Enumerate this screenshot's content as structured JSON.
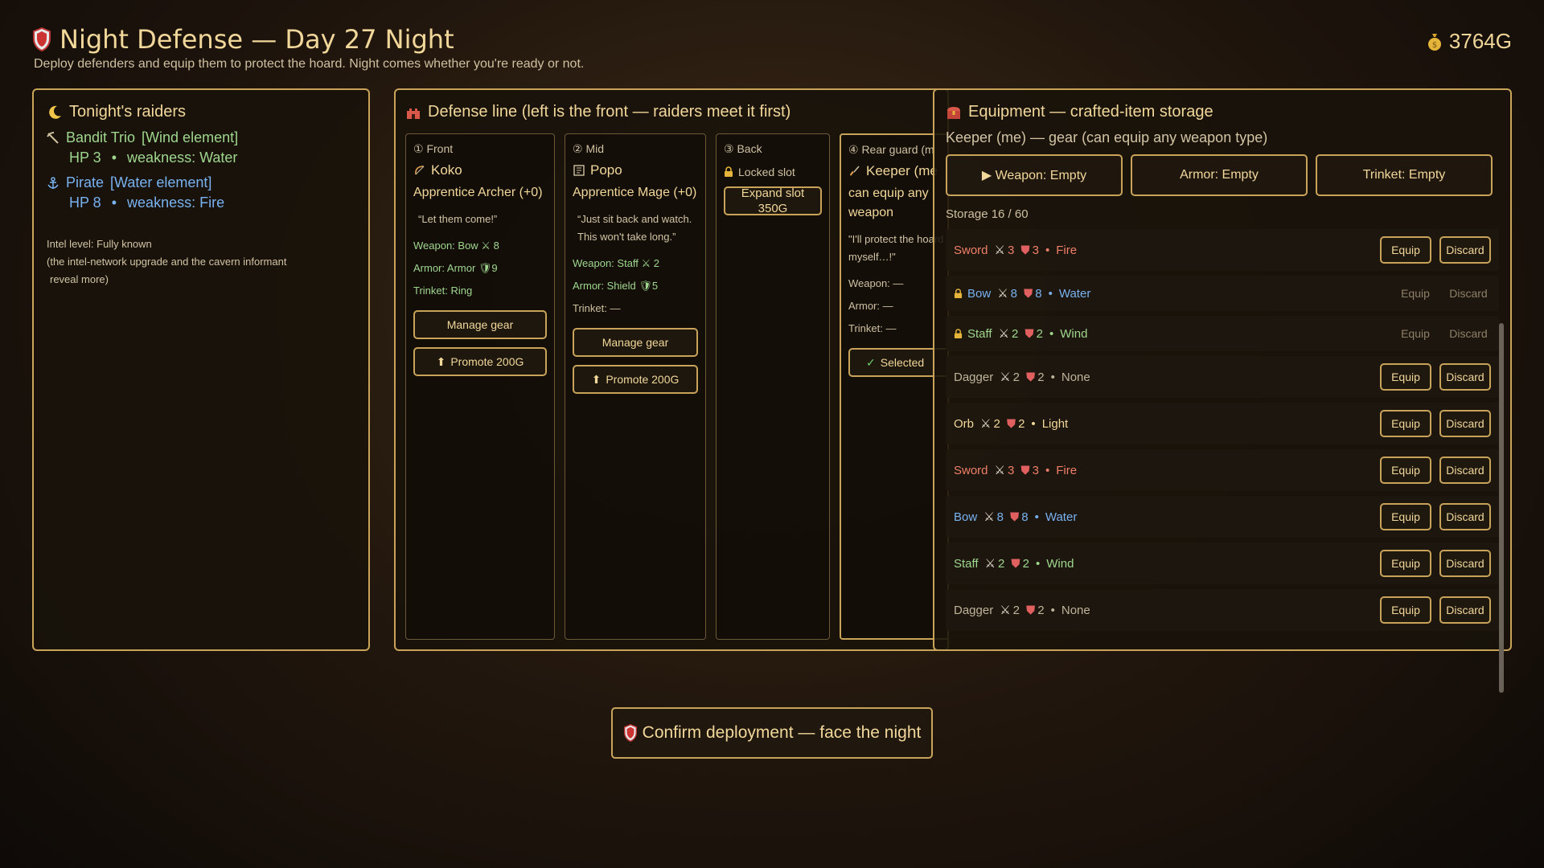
{
  "header": {
    "title": "Night Defense — Day 27 Night",
    "subtitle": "Deploy defenders and equip them to protect the hoard. Night comes whether you're ready or not.",
    "gold": "3764G"
  },
  "raiders": {
    "title": "Tonight's raiders",
    "list": [
      {
        "name": "Bandit Trio",
        "element": "[Wind element]",
        "hp": "HP 3",
        "sep": "•",
        "weakness": "weakness: Water",
        "color": "#9fd68e",
        "icon": "pickaxe-icon"
      },
      {
        "name": "Pirate",
        "element": "[Water element]",
        "hp": "HP 8",
        "sep": "•",
        "weakness": "weakness: Fire",
        "color": "#78b2f0",
        "icon": "anchor-icon"
      }
    ],
    "intel_level": "Intel level: Fully known",
    "intel_note_1": "(the intel-network upgrade and the cavern informant",
    "intel_note_2": "reveal more)"
  },
  "defense": {
    "title": "Defense line  (left is the front — raiders meet it first)",
    "slots": [
      {
        "pos": "① Front",
        "name": "Koko",
        "class": "Apprentice Archer (+0)",
        "quote": "“Let them come!”",
        "weapon": "Weapon: Bow ⚔ 8",
        "armor": "Armor: Armor 🛡9",
        "trinket": "Trinket: Ring",
        "manage": "Manage gear",
        "promote": "Promote 200G"
      },
      {
        "pos": "② Mid",
        "name": "Popo",
        "class": "Apprentice Mage (+0)",
        "quote": "“Just sit back and watch. This won't take long.”",
        "weapon": "Weapon: Staff ⚔ 2",
        "armor": "Armor: Shield 🛡5",
        "trinket": "Trinket: —",
        "manage": "Manage gear",
        "promote": "Promote 200G"
      },
      {
        "pos": "③ Back",
        "locked": "Locked slot",
        "expand_1": "Expand slot",
        "expand_2": "350G"
      },
      {
        "pos": "④ Rear guard (m",
        "name": "Keeper (me",
        "class": "can equip any weapon",
        "quote": "\"I'll protect the hoard myself…!\"",
        "weapon": "Weapon: —",
        "armor": "Armor: —",
        "trinket": "Trinket: —",
        "selected": "Selected"
      }
    ]
  },
  "equipment": {
    "title": "Equipment — crafted-item storage",
    "subtitle": "Keeper (me) — gear  (can equip any weapon type)",
    "weapon_btn": "▶ Weapon: Empty",
    "armor_btn": "Armor: Empty",
    "trinket_btn": "Trinket: Empty",
    "storage": "Storage 16 / 60",
    "equip_label": "Equip",
    "discard_label": "Discard",
    "items": [
      {
        "name": "Sword",
        "atk": "3",
        "def": "3",
        "element": "Fire",
        "color": "#f07f68",
        "locked": false
      },
      {
        "name": "Bow",
        "atk": "8",
        "def": "8",
        "element": "Water",
        "color": "#78b2f0",
        "locked": true
      },
      {
        "name": "Staff",
        "atk": "2",
        "def": "2",
        "element": "Wind",
        "color": "#9fd68e",
        "locked": true
      },
      {
        "name": "Dagger",
        "atk": "2",
        "def": "2",
        "element": "None",
        "color": "#bfb39a",
        "locked": false
      },
      {
        "name": "Orb",
        "atk": "2",
        "def": "2",
        "element": "Light",
        "color": "#f1d79a",
        "locked": false
      },
      {
        "name": "Sword",
        "atk": "3",
        "def": "3",
        "element": "Fire",
        "color": "#f07f68",
        "locked": false
      },
      {
        "name": "Bow",
        "atk": "8",
        "def": "8",
        "element": "Water",
        "color": "#78b2f0",
        "locked": false
      },
      {
        "name": "Staff",
        "atk": "2",
        "def": "2",
        "element": "Wind",
        "color": "#9fd68e",
        "locked": false
      },
      {
        "name": "Dagger",
        "atk": "2",
        "def": "2",
        "element": "None",
        "color": "#bfb39a",
        "locked": false
      }
    ]
  },
  "confirm": "Confirm deployment — face the night",
  "colors": {
    "accent": "#c9a35a",
    "text": "#f1d79a"
  }
}
